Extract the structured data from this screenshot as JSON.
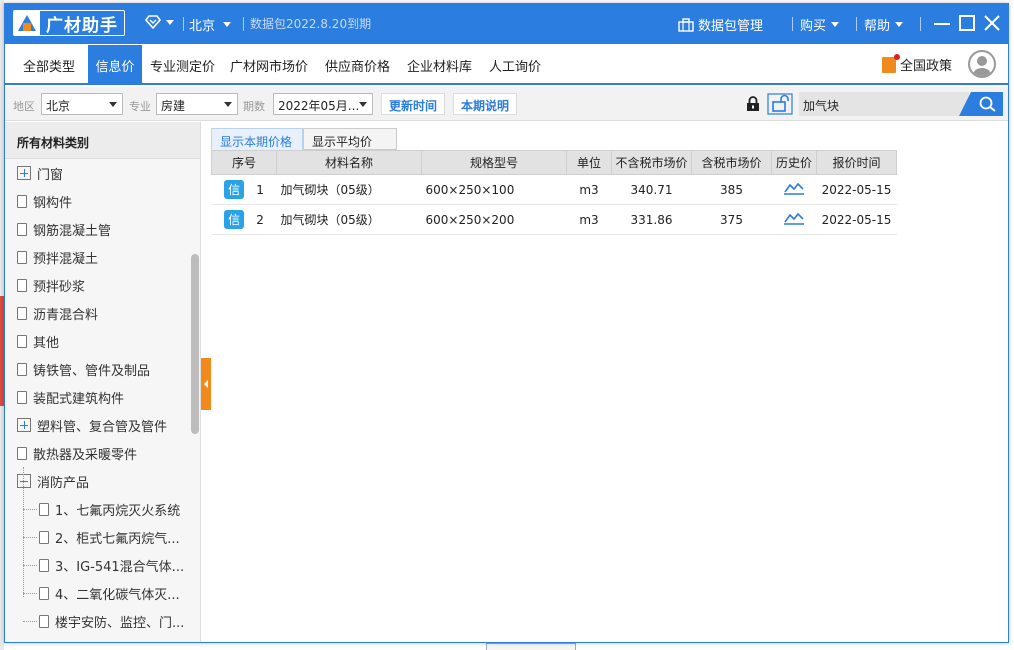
{
  "app": {
    "logo_text": "广材助手",
    "city": "北京",
    "expiry_notice": "数据包2022.8.20到期",
    "data_package": "数据包管理",
    "buy": "购买",
    "help": "帮助"
  },
  "menu": {
    "items": [
      "全部类型",
      "信息价",
      "专业测定价",
      "广材网市场价",
      "供应商价格",
      "企业材料库",
      "人工询价"
    ],
    "active_index": 1,
    "policy": "全国政策"
  },
  "filters": {
    "region_label": "地区",
    "region_value": "北京",
    "specialty_label": "专业",
    "specialty_value": "房建",
    "period_label": "期数",
    "period_value": "2022年05月...",
    "update_time_btn": "更新时间",
    "period_note_btn": "本期说明",
    "search_value": "加气块"
  },
  "sidebar": {
    "header": "所有材料类别",
    "items": [
      {
        "label": "门窗",
        "type": "expand"
      },
      {
        "label": "钢构件",
        "type": "doc"
      },
      {
        "label": "钢筋混凝土管",
        "type": "doc"
      },
      {
        "label": "预拌混凝土",
        "type": "doc"
      },
      {
        "label": "预拌砂浆",
        "type": "doc"
      },
      {
        "label": "沥青混合料",
        "type": "doc"
      },
      {
        "label": "其他",
        "type": "doc"
      },
      {
        "label": "铸铁管、管件及制品",
        "type": "doc"
      },
      {
        "label": "装配式建筑构件",
        "type": "doc"
      },
      {
        "label": "塑料管、复合管及管件",
        "type": "expand"
      },
      {
        "label": "散热器及采暖零件",
        "type": "doc"
      },
      {
        "label": "消防产品",
        "type": "collapse"
      },
      {
        "label": "1、七氟丙烷灭火系统",
        "type": "child"
      },
      {
        "label": "2、柜式七氟丙烷气...",
        "type": "child"
      },
      {
        "label": "3、IG-541混合气体...",
        "type": "child"
      },
      {
        "label": "4、二氧化碳气体灭...",
        "type": "child"
      },
      {
        "label": "楼宇安防、监控、门...",
        "type": "child"
      }
    ]
  },
  "tabs": [
    "显示本期价格",
    "显示平均价"
  ],
  "table": {
    "headers": [
      "序号",
      "材料名称",
      "规格型号",
      "单位",
      "不含税市场价",
      "含税市场价",
      "历史价",
      "报价时间"
    ],
    "rows": [
      {
        "badge": "信",
        "no": "1",
        "name": "加气砌块（05级）",
        "spec": "600×250×100",
        "unit": "m3",
        "price_ex": "340.71",
        "price_in": "385",
        "date": "2022-05-15"
      },
      {
        "badge": "信",
        "no": "2",
        "name": "加气砌块（05级）",
        "spec": "600×250×200",
        "unit": "m3",
        "price_ex": "331.86",
        "price_in": "375",
        "date": "2022-05-15"
      }
    ]
  },
  "colors": {
    "brand": "#2b7de0",
    "accent": "#f08a1c",
    "badge": "#2aa3e6"
  }
}
